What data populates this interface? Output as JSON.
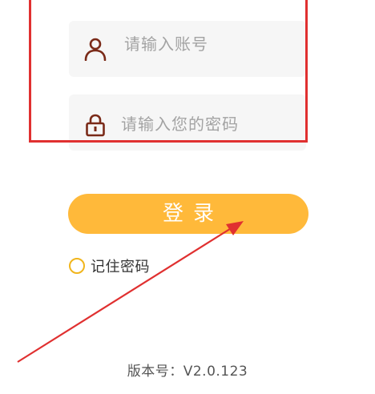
{
  "form": {
    "account_placeholder": "请输入账号",
    "password_placeholder": "请输入您的密码",
    "login_label": "登录",
    "remember_label": "记住密码"
  },
  "footer": {
    "version_text": "版本号：V2.0.123"
  },
  "icons": {
    "account": "user-icon",
    "password": "lock-icon"
  },
  "colors": {
    "accent": "#ffb93a",
    "icon_color": "#7a2a18",
    "annotation_red": "#e03030",
    "checkbox_border": "#f1b51c"
  }
}
